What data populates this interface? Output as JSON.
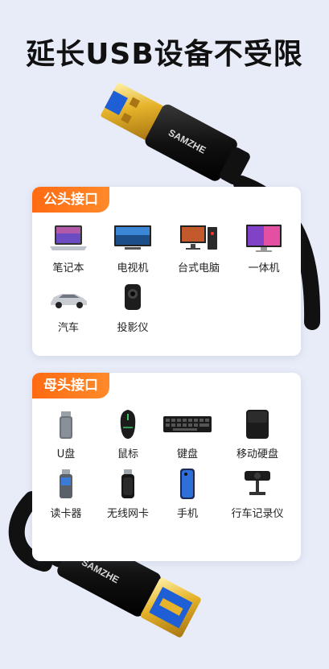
{
  "headline": "延长USB设备不受限",
  "brand": "SAMZHE",
  "sections": {
    "male": {
      "tag": "公头接口",
      "items": [
        {
          "label": "笔记本",
          "icon": "laptop-icon"
        },
        {
          "label": "电视机",
          "icon": "tv-icon"
        },
        {
          "label": "台式电脑",
          "icon": "desktop-pc-icon"
        },
        {
          "label": "一体机",
          "icon": "all-in-one-pc-icon"
        },
        {
          "label": "汽车",
          "icon": "car-icon"
        },
        {
          "label": "投影仪",
          "icon": "projector-icon"
        }
      ]
    },
    "female": {
      "tag": "母头接口",
      "items": [
        {
          "label": "U盘",
          "icon": "usb-drive-icon"
        },
        {
          "label": "鼠标",
          "icon": "mouse-icon"
        },
        {
          "label": "键盘",
          "icon": "keyboard-icon"
        },
        {
          "label": "移动硬盘",
          "icon": "external-hdd-icon"
        },
        {
          "label": "读卡器",
          "icon": "card-reader-icon"
        },
        {
          "label": "无线网卡",
          "icon": "wifi-adapter-icon"
        },
        {
          "label": "手机",
          "icon": "phone-icon"
        },
        {
          "label": "行车记录仪",
          "icon": "dashcam-icon"
        }
      ]
    }
  },
  "colors": {
    "background": "#e8ecf8",
    "tag": "#ff7a1a",
    "usb_blue": "#1f5fd6",
    "gold": "#e6b32a",
    "cable": "#141414"
  }
}
